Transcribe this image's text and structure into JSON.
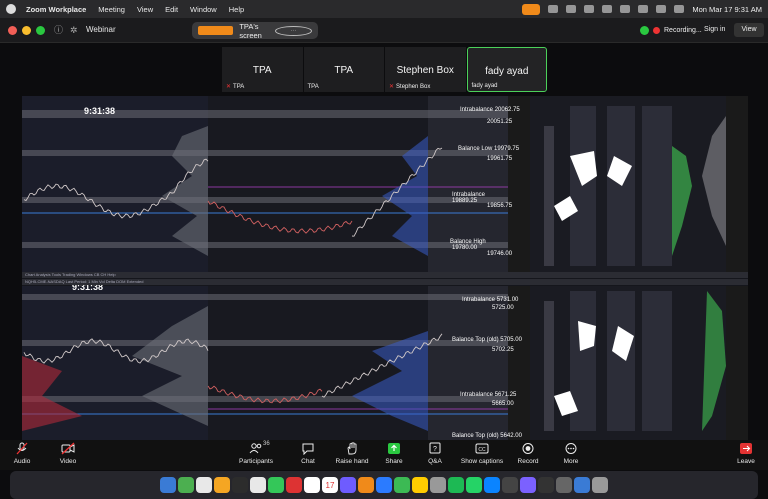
{
  "menubar": {
    "app_name": "Zoom Workplace",
    "items": [
      "Meeting",
      "View",
      "Edit",
      "Window",
      "Help"
    ],
    "clock": "Mon Mar 17  9:31 AM"
  },
  "titlebar": {
    "webinar_label": "Webinar",
    "share_title": "TPA's screen",
    "recording_label": "Recording...",
    "sign_in": "Sign in",
    "view": "View"
  },
  "participants": [
    {
      "big": "TPA",
      "small": "TPA",
      "muted": true,
      "active": false
    },
    {
      "big": "TPA",
      "small": "TPA",
      "muted": false,
      "active": false
    },
    {
      "big": "Stephen Box",
      "small": "Stephen Box",
      "muted": true,
      "active": false
    },
    {
      "big": "fady ayad",
      "small": "fady ayad",
      "muted": false,
      "active": true
    }
  ],
  "screen": {
    "top_time": "9:31:38",
    "bottom_time": "9:31:38",
    "top_levels": {
      "intrabalance": "Intrabalance 20062.75",
      "p1": "20051.25",
      "balance_low": "Balance Low 19979.75",
      "p2": "19961.75",
      "intrabalance2": "Intrabalance",
      "p3": "19889.25",
      "p4": "19856.75",
      "balance_high": "Balance High",
      "p5": "19780.00",
      "p6": "19746.00"
    },
    "bottom_levels": {
      "intrabalance": "Intrabalance 5731.00",
      "p1": "5725.00",
      "balance_top": "Balance Top (old) 5705.00",
      "p2": "5702.25",
      "intrabalance2": "Intrabalance 5671.25",
      "p3": "5665.00",
      "balance_top2": "Balance Top (old) 5642.00"
    },
    "toolbar_text": "Chart  Analysis  Tools  Trading  Windows  CB  CH  Help",
    "toolbar_text2": "NQH5-CME-NASDAQ  Last  Period: 1 Min  Vol  Delta  DOM  Extended"
  },
  "controls": {
    "audio": "Audio",
    "video": "Video",
    "participants": "Participants",
    "participants_count": "36",
    "chat": "Chat",
    "raise_hand": "Raise hand",
    "share": "Share",
    "qa": "Q&A",
    "captions": "Show captions",
    "record": "Record",
    "more": "More",
    "leave": "Leave"
  },
  "dock": {
    "calendar_day": "17"
  },
  "colors": {
    "active_border": "#4cd15a",
    "recording_red": "#e33333",
    "share_green": "#2ac840",
    "leave_red": "#e33333"
  }
}
